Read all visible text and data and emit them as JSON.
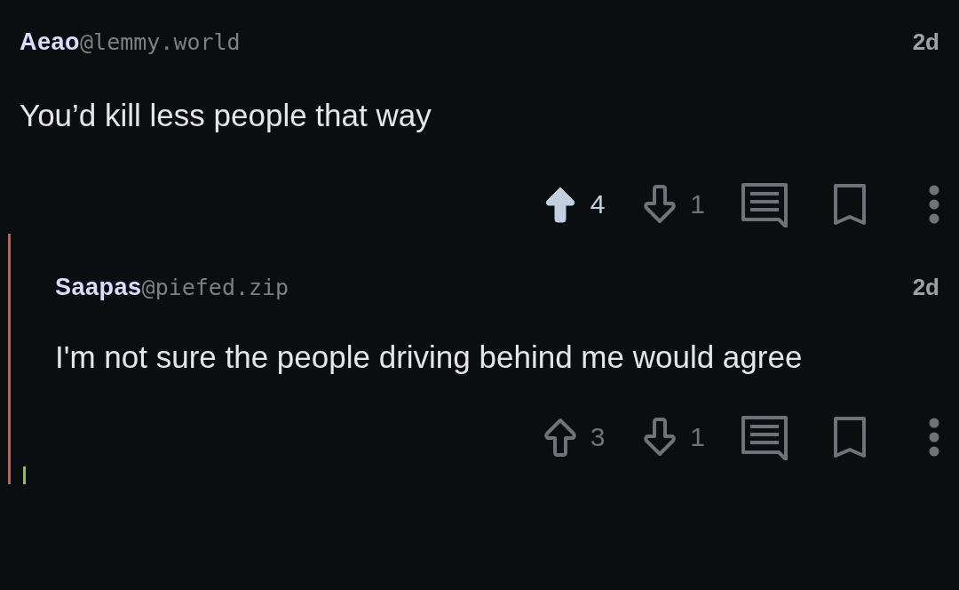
{
  "comments": [
    {
      "user": "Aeao",
      "instance": "@lemmy.world",
      "age": "2d",
      "body": "You’d kill less people that way",
      "upvotes": "4",
      "upvoted": true,
      "downvotes": "1",
      "downvoted": false,
      "saved": false,
      "children": [
        {
          "user": "Saapas",
          "instance": "@piefed.zip",
          "age": "2d",
          "body": "I'm not sure the people driving behind me would agree",
          "upvotes": "3",
          "upvoted": false,
          "downvotes": "1",
          "downvoted": false,
          "saved": false,
          "color": "#b4625c",
          "children": [
            {
              "color": "#8cc05a"
            }
          ]
        }
      ]
    }
  ]
}
